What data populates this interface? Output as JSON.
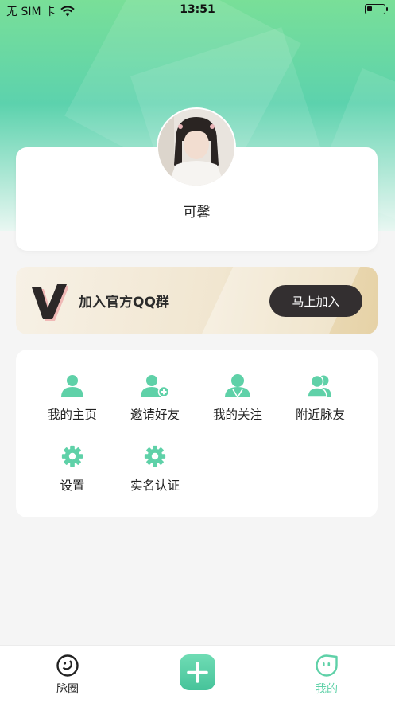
{
  "status_bar": {
    "carrier": "无 SIM 卡",
    "time": "13:51"
  },
  "profile": {
    "username": "可馨"
  },
  "banner": {
    "text": "加入官方QQ群",
    "button_label": "马上加入"
  },
  "menu": {
    "items": [
      {
        "label": "我的主页",
        "icon": "user-icon"
      },
      {
        "label": "邀请好友",
        "icon": "add-user-icon"
      },
      {
        "label": "我的关注",
        "icon": "follow-icon"
      },
      {
        "label": "附近脉友",
        "icon": "nearby-friends-icon"
      },
      {
        "label": "设置",
        "icon": "gear-icon"
      },
      {
        "label": "实名认证",
        "icon": "gear-icon"
      }
    ]
  },
  "tab_bar": {
    "items": [
      {
        "label": "脉圈",
        "icon": "circle-icon",
        "active": false
      },
      {
        "label": "",
        "icon": "plus-icon",
        "active": false
      },
      {
        "label": "我的",
        "icon": "mine-face-icon",
        "active": true
      }
    ]
  },
  "colors": {
    "accent": "#5fd1a8",
    "dark_button": "#332f30",
    "active_tab": "#5fd1a8"
  }
}
